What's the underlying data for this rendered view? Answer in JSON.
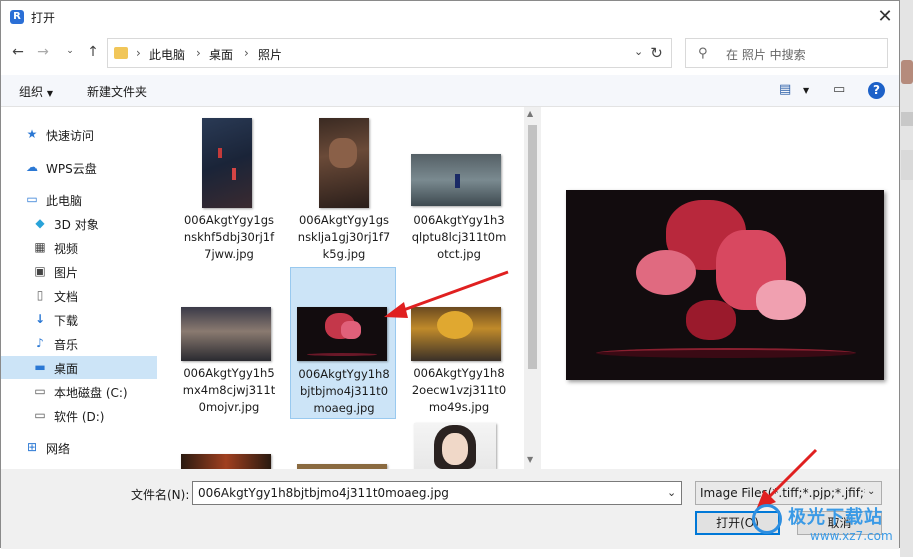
{
  "window": {
    "title": "打开"
  },
  "nav": {
    "breadcrumb": [
      "此电脑",
      "桌面",
      "照片"
    ],
    "search_placeholder": "在 照片 中搜索"
  },
  "toolbar": {
    "organize": "组织",
    "new_folder": "新建文件夹"
  },
  "sidebar": {
    "items": [
      {
        "label": "快速访问",
        "icon": "star-icon"
      },
      {
        "label": "WPS云盘",
        "icon": "cloud-icon"
      },
      {
        "label": "此电脑",
        "icon": "computer-icon"
      },
      {
        "label": "3D 对象",
        "icon": "cube-icon"
      },
      {
        "label": "视频",
        "icon": "video-icon"
      },
      {
        "label": "图片",
        "icon": "picture-icon"
      },
      {
        "label": "文档",
        "icon": "document-icon"
      },
      {
        "label": "下载",
        "icon": "download-icon"
      },
      {
        "label": "音乐",
        "icon": "music-icon"
      },
      {
        "label": "桌面",
        "icon": "desktop-icon",
        "selected": true
      },
      {
        "label": "本地磁盘 (C:)",
        "icon": "drive-icon"
      },
      {
        "label": "软件 (D:)",
        "icon": "drive-icon"
      },
      {
        "label": "网络",
        "icon": "network-icon"
      }
    ]
  },
  "files": [
    {
      "name": "006AkgtYgy1gsnskhf5dbj30rj1f7jww.jpg",
      "lines": "006AkgtYgy1gs\nnskhf5dbj30rj1f\n7jww.jpg"
    },
    {
      "name": "006AkgtYgy1gsnsklja1gj30rj1f7k5g.jpg",
      "lines": "006AkgtYgy1gs\nnsklja1gj30rj1f7\nk5g.jpg"
    },
    {
      "name": "006AkgtYgy1h3qlptu8lcj311t0motct.jpg",
      "lines": "006AkgtYgy1h3\nqlptu8lcj311t0m\notct.jpg"
    },
    {
      "name": "006AkgtYgy1h5mx4m8cjwj311t0mojvr.jpg",
      "lines": "006AkgtYgy1h5\nmx4m8cjwj311t\n0mojvr.jpg"
    },
    {
      "name": "006AkgtYgy1h8bjtbjmo4j311t0moaeg.jpg",
      "lines": "006AkgtYgy1h8\nbjtbjmo4j311t0\nmoaeg.jpg",
      "selected": true
    },
    {
      "name": "006AkgtYgy1h82oecw1vzj311t0mo49s.jpg",
      "lines": "006AkgtYgy1h8\n2oecw1vzj311t0\nmo49s.jpg"
    }
  ],
  "bottom": {
    "filename_label": "文件名(N):",
    "filename_value": "006AkgtYgy1h8bjtbjmo4j311t0moaeg.jpg",
    "filetype_value": "Image Files(*.tiff;*.pjp;*.jfif;*.",
    "open_label": "打开(O)",
    "cancel_label": "取消"
  },
  "watermark": {
    "brand": "极光下载站",
    "url": "www.xz7.com"
  },
  "colors": {
    "accent": "#0078d7",
    "selection": "#cce4f7",
    "arrow": "#e02020"
  }
}
